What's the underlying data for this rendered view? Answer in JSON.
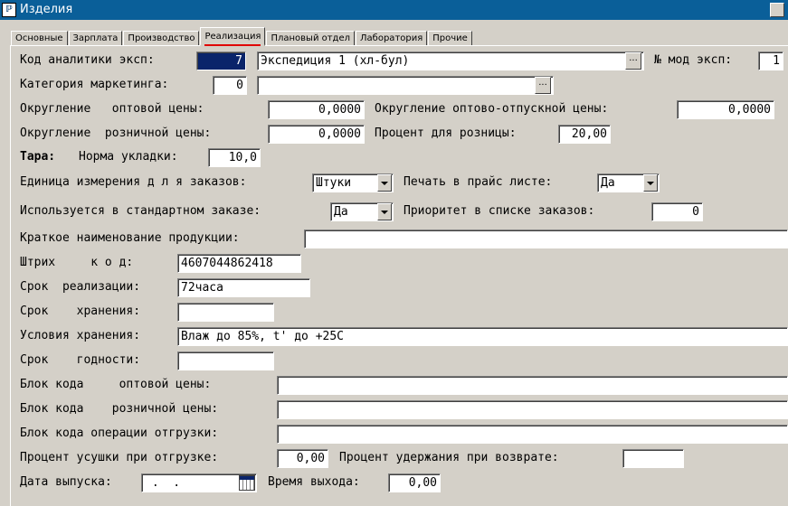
{
  "window": {
    "title": "Изделия",
    "icon": "app-icon"
  },
  "tabs": [
    {
      "label": "Основные"
    },
    {
      "label": "Зарплата"
    },
    {
      "label": "Производство"
    },
    {
      "label": "Реализация"
    },
    {
      "label": "Плановый отдел"
    },
    {
      "label": "Лаборатория"
    },
    {
      "label": "Прочие"
    }
  ],
  "active_tab": "Реализация",
  "form": {
    "code_analytics": {
      "label": "Код аналитики эксп:",
      "value": "7",
      "name": "Экспедиция 1 (хл-бул)"
    },
    "mod_exp": {
      "label": "№ мод эксп:",
      "value": "1"
    },
    "marketing_category": {
      "label": "Категория маркетинга:",
      "value": "0",
      "name": ""
    },
    "rounding_wholesale": {
      "label": "Округление   оптовой цены:",
      "value": "0,0000"
    },
    "rounding_wholesale_release": {
      "label": "Округление оптово-отпускной цены:",
      "value": "0,0000"
    },
    "rounding_retail": {
      "label": "Округление  розничной цены:",
      "value": "0,0000"
    },
    "retail_percent": {
      "label": "Процент для розницы:",
      "value": "20,00"
    },
    "tara": {
      "label": "Тара:",
      "norm_label": "Норма укладки:",
      "value": "10,0"
    },
    "order_unit": {
      "label": "Единица измерения д л я заказов:",
      "value": "Штуки"
    },
    "price_print": {
      "label": "Печать в прайс листе:",
      "value": "Да"
    },
    "std_order": {
      "label": "Используется в стандартном заказе:",
      "value": "Да"
    },
    "order_priority": {
      "label": "Приоритет в списке заказов:",
      "value": "0"
    },
    "short_name": {
      "label": "Краткое наименование продукции:",
      "value": ""
    },
    "barcode": {
      "label": "Штрих     к о д:",
      "value": "4607044862418"
    },
    "sale_term": {
      "label": "Срок  реализации:",
      "value": "72часа"
    },
    "storage_term": {
      "label": "Срок    хранения:",
      "value": ""
    },
    "storage_conditions": {
      "label": "Условия хранения:",
      "value": "Влаж до 85%, t' до +25С"
    },
    "shelf_life": {
      "label": "Срок    годности:",
      "value": ""
    },
    "wholesale_code_block": {
      "label": "Блок кода     оптовой цены:",
      "value": ""
    },
    "retail_code_block": {
      "label": "Блок кода    розничной цены:",
      "value": ""
    },
    "shipment_code_block": {
      "label": "Блок кода операции отгрузки:",
      "value": ""
    },
    "shrink_percent": {
      "label": "Процент усушки при отгрузке:",
      "value": "0,00"
    },
    "return_percent": {
      "label": "Процент удержания при возврате:",
      "value": ""
    },
    "release_date": {
      "label": "Дата выпуска:",
      "value": " .  ."
    },
    "release_time": {
      "label": "Время выхода:",
      "value": "0,00"
    }
  },
  "icons": {
    "ellipsis": "...",
    "calendar": "calendar-icon",
    "dropdown": "chevron-down-icon"
  }
}
